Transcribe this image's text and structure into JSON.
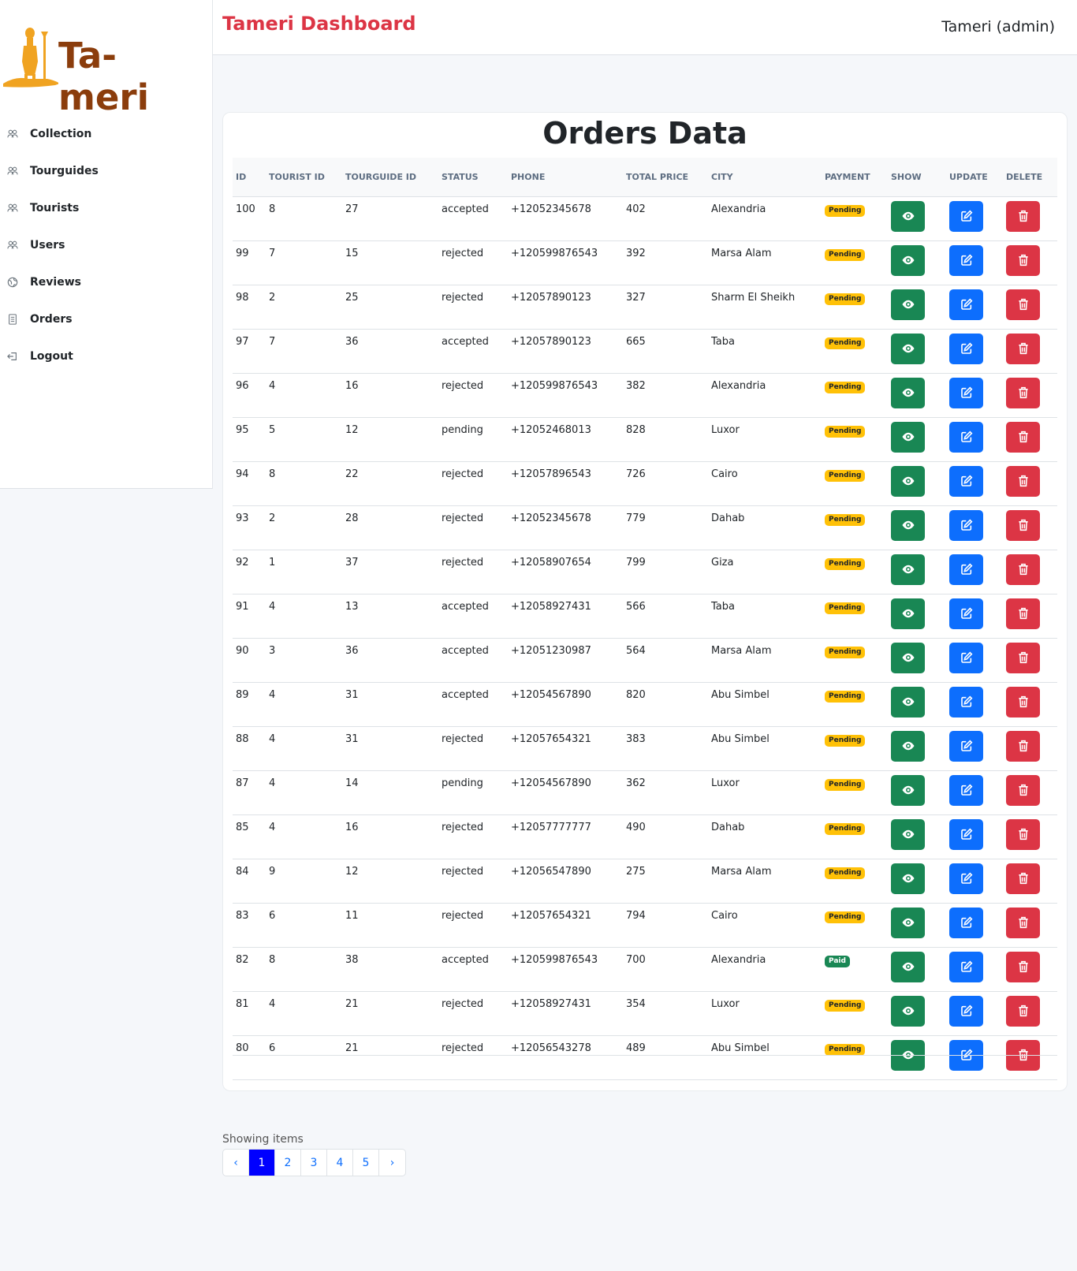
{
  "logo": {
    "text": "Ta-meri",
    "color": "#8b3d0c",
    "figure_color": "#f0a321"
  },
  "sidebar": {
    "items": [
      {
        "label": "Collection",
        "icon": "users-icon"
      },
      {
        "label": "Tourguides",
        "icon": "users-icon"
      },
      {
        "label": "Tourists",
        "icon": "users-icon"
      },
      {
        "label": "Users",
        "icon": "users-icon"
      },
      {
        "label": "Reviews",
        "icon": "globe-icon"
      },
      {
        "label": "Orders",
        "icon": "document-icon"
      },
      {
        "label": "Logout",
        "icon": "logout-icon"
      }
    ]
  },
  "header": {
    "title": "Tameri Dashboard",
    "user": "Tameri (admin)"
  },
  "main": {
    "title": "Orders Data"
  },
  "table": {
    "columns": [
      "ID",
      "TOURIST ID",
      "TOURGUIDE ID",
      "STATUS",
      "PHONE",
      "TOTAL PRICE",
      "CITY",
      "PAYMENT",
      "SHOW",
      "UPDATE",
      "DELETE"
    ],
    "rows": [
      [
        "100",
        "8",
        "27",
        "accepted",
        "+12052345678",
        "402",
        "Alexandria",
        "Pending"
      ],
      [
        "99",
        "7",
        "15",
        "rejected",
        "+120599876543",
        "392",
        "Marsa Alam",
        "Pending"
      ],
      [
        "98",
        "2",
        "25",
        "rejected",
        "+12057890123",
        "327",
        "Sharm El Sheikh",
        "Pending"
      ],
      [
        "97",
        "7",
        "36",
        "accepted",
        "+12057890123",
        "665",
        "Taba",
        "Pending"
      ],
      [
        "96",
        "4",
        "16",
        "rejected",
        "+120599876543",
        "382",
        "Alexandria",
        "Pending"
      ],
      [
        "95",
        "5",
        "12",
        "pending",
        "+12052468013",
        "828",
        "Luxor",
        "Pending"
      ],
      [
        "94",
        "8",
        "22",
        "rejected",
        "+12057896543",
        "726",
        "Cairo",
        "Pending"
      ],
      [
        "93",
        "2",
        "28",
        "rejected",
        "+12052345678",
        "779",
        "Dahab",
        "Pending"
      ],
      [
        "92",
        "1",
        "37",
        "rejected",
        "+12058907654",
        "799",
        "Giza",
        "Pending"
      ],
      [
        "91",
        "4",
        "13",
        "accepted",
        "+12058927431",
        "566",
        "Taba",
        "Pending"
      ],
      [
        "90",
        "3",
        "36",
        "accepted",
        "+12051230987",
        "564",
        "Marsa Alam",
        "Pending"
      ],
      [
        "89",
        "4",
        "31",
        "accepted",
        "+12054567890",
        "820",
        "Abu Simbel",
        "Pending"
      ],
      [
        "88",
        "4",
        "31",
        "rejected",
        "+12057654321",
        "383",
        "Abu Simbel",
        "Pending"
      ],
      [
        "87",
        "4",
        "14",
        "pending",
        "+12054567890",
        "362",
        "Luxor",
        "Pending"
      ],
      [
        "85",
        "4",
        "16",
        "rejected",
        "+12057777777",
        "490",
        "Dahab",
        "Pending"
      ],
      [
        "84",
        "9",
        "12",
        "rejected",
        "+12056547890",
        "275",
        "Marsa Alam",
        "Pending"
      ],
      [
        "83",
        "6",
        "11",
        "rejected",
        "+12057654321",
        "794",
        "Cairo",
        "Pending"
      ],
      [
        "82",
        "8",
        "38",
        "accepted",
        "+120599876543",
        "700",
        "Alexandria",
        "Paid"
      ],
      [
        "81",
        "4",
        "21",
        "rejected",
        "+12058927431",
        "354",
        "Luxor",
        "Pending"
      ],
      [
        "80",
        "6",
        "21",
        "rejected",
        "+12056543278",
        "489",
        "Abu Simbel",
        "Pending"
      ]
    ]
  },
  "pagination": {
    "label": "Showing items",
    "prev": "‹",
    "next": "›",
    "pages": [
      "1",
      "2",
      "3",
      "4",
      "5"
    ],
    "active": "1"
  },
  "colors": {
    "brand": "#dc3545",
    "show": "#198754",
    "update": "#0d6efd",
    "delete": "#dc3545",
    "pending": "#ffc107",
    "paid": "#198754",
    "active_page": "#0000ff"
  }
}
